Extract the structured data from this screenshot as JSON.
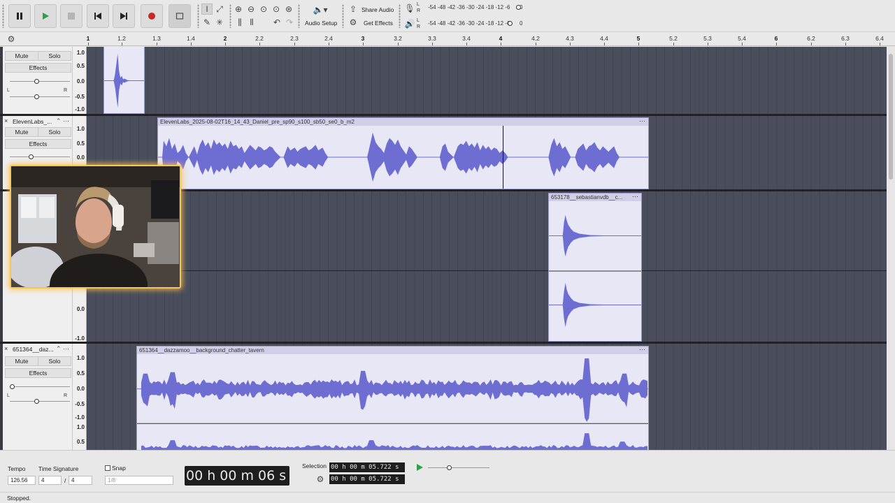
{
  "toolbar": {
    "share_audio_label": "Share Audio",
    "get_effects_label": "Get Effects",
    "audio_setup_label": "Audio Setup",
    "meter_scale_record": "-54 -48 -42 -36 -30 -24 -18 -12 -6",
    "meter_scale_play": "-54 -48 -42 -36 -30 -24 -18 -12 -6",
    "meter_record_zero": "0",
    "meter_play_zero": "0",
    "lr_left": "L",
    "lr_right": "R"
  },
  "ruler": {
    "ticks": [
      {
        "label": "1",
        "major": true
      },
      {
        "label": "1.2",
        "major": false
      },
      {
        "label": "1.3",
        "major": false
      },
      {
        "label": "1.4",
        "major": false
      },
      {
        "label": "2",
        "major": true
      },
      {
        "label": "2.2",
        "major": false
      },
      {
        "label": "2.3",
        "major": false
      },
      {
        "label": "2.4",
        "major": false
      },
      {
        "label": "3",
        "major": true
      },
      {
        "label": "3.2",
        "major": false
      },
      {
        "label": "3.3",
        "major": false
      },
      {
        "label": "3.4",
        "major": false
      },
      {
        "label": "4",
        "major": true
      },
      {
        "label": "4.2",
        "major": false
      },
      {
        "label": "4.3",
        "major": false
      },
      {
        "label": "4.4",
        "major": false
      },
      {
        "label": "5",
        "major": true
      },
      {
        "label": "5.2",
        "major": false
      },
      {
        "label": "5.3",
        "major": false
      },
      {
        "label": "5.4",
        "major": false
      },
      {
        "label": "6",
        "major": true
      },
      {
        "label": "6.2",
        "major": false
      },
      {
        "label": "6.3",
        "major": false
      },
      {
        "label": "6.4",
        "major": false
      }
    ]
  },
  "tracks": {
    "mute_label": "Mute",
    "solo_label": "Solo",
    "effects_label": "Effects",
    "pan_left": "L",
    "pan_right": "R",
    "scale_labels": [
      "1.0",
      "0.5",
      "0.0",
      "-0.5",
      "-1.0"
    ],
    "track1": {},
    "track2": {
      "name": "ElevenLabs_...",
      "clip_name": "ElevenLabs_2025-08-02T16_14_43_Daniel_pre_sp90_s100_sb50_se0_b_m2"
    },
    "track3": {
      "clip_name": "653178__sebastianvdb__c..."
    },
    "track4": {
      "name": "651364__daz...",
      "clip_name": "651364__dazzamoo__background_chatter_tavern"
    }
  },
  "bottom": {
    "tempo_label": "Tempo",
    "tempo_value": "126.56",
    "time_signature_label": "Time Signature",
    "time_sig_num": "4",
    "time_sig_den": "4",
    "time_sig_sep": "/",
    "snap_label": "Snap",
    "snap_value": "1/8",
    "time_display": "00 h 00 m 06 s",
    "selection_label": "Selection",
    "selection_start": "00 h 00 m 05.722 s",
    "selection_end": "00 h 00 m 05.722 s"
  },
  "status": {
    "text": "Stopped."
  },
  "colors": {
    "waveform": "#6e6ed2",
    "accent": "#f5c55a",
    "record": "#c62828",
    "play": "#2e9e4f"
  }
}
